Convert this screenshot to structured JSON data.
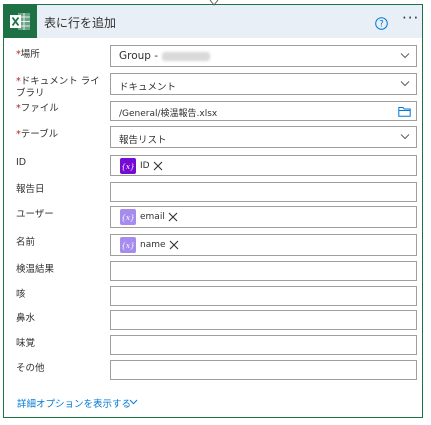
{
  "header": {
    "title": "表に行を追加",
    "help_icon": "help-circle-icon",
    "more_icon": "more-options-icon",
    "more_label": "···",
    "app_icon": "excel-icon",
    "app_color": "#1e7145",
    "header_bg": "#e9eff6"
  },
  "fields": {
    "location": {
      "required_mark": "*",
      "label": "場所",
      "value": "Group -"
    },
    "library": {
      "required_mark": "*",
      "label": "ドキュメント ライブラリ",
      "value": "ドキュメント"
    },
    "file": {
      "required_mark": "*",
      "label": "ファイル",
      "value": "/General/検温報告.xlsx"
    },
    "table": {
      "required_mark": "*",
      "label": "テーブル",
      "value": "報告リスト"
    },
    "id": {
      "label": "ID",
      "token": {
        "badge": "{x}",
        "label": "ID",
        "color": "#770bd6"
      }
    },
    "report_date": {
      "label": "報告日",
      "value": ""
    },
    "user": {
      "label": "ユーザー",
      "token": {
        "badge": "{x}",
        "label": "email",
        "color": "#a58ced"
      }
    },
    "name": {
      "label": "名前",
      "token": {
        "badge": "{x}",
        "label": "name",
        "color": "#a58ced"
      }
    },
    "temperature": {
      "label": "検温結果",
      "value": ""
    },
    "cough": {
      "label": "咳",
      "value": ""
    },
    "runny_nose": {
      "label": "鼻水",
      "value": ""
    },
    "taste": {
      "label": "味覚",
      "value": ""
    },
    "other": {
      "label": "その他",
      "value": ""
    }
  },
  "advanced": {
    "label": "詳細オプションを表示する"
  },
  "colors": {
    "required": "#a4262c",
    "link": "#0078d4",
    "border": "#a19f9d"
  }
}
